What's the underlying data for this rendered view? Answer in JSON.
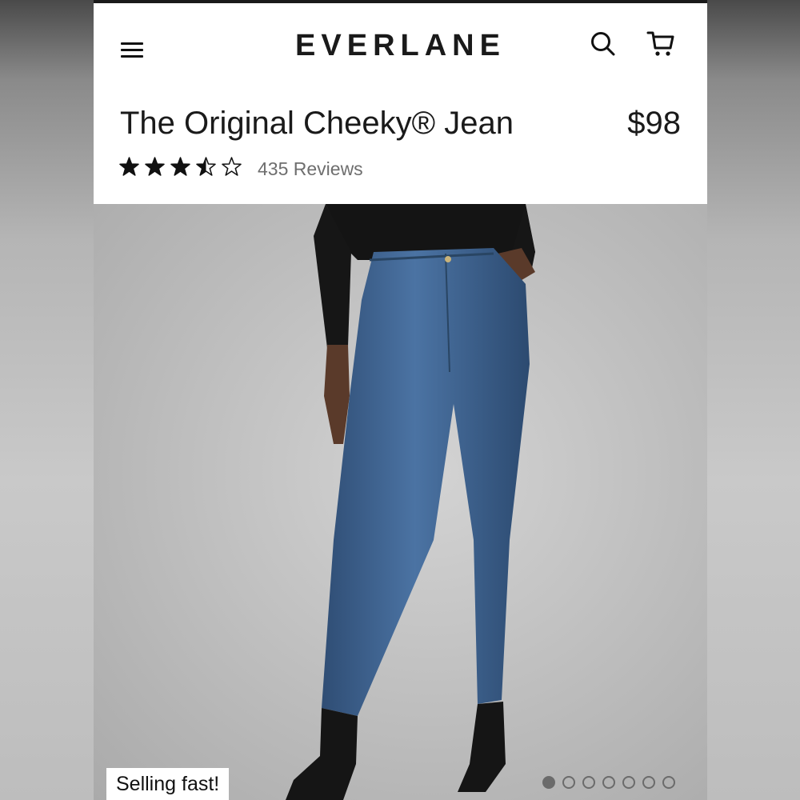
{
  "brand": {
    "logo_text": "EVERLANE"
  },
  "header": {
    "menu_icon": "hamburger-menu-icon",
    "search_icon": "search-icon",
    "cart_icon": "shopping-cart-icon"
  },
  "product": {
    "title": "The Original Cheeky® Jean",
    "price": "$98",
    "rating": 3.5,
    "rating_max": 5,
    "reviews_label": "435 Reviews"
  },
  "gallery": {
    "badge": "Selling fast!",
    "slide_count": 7,
    "active_slide": 1,
    "background": "#c4c4c4",
    "denim_color": "#3b5e8a"
  }
}
